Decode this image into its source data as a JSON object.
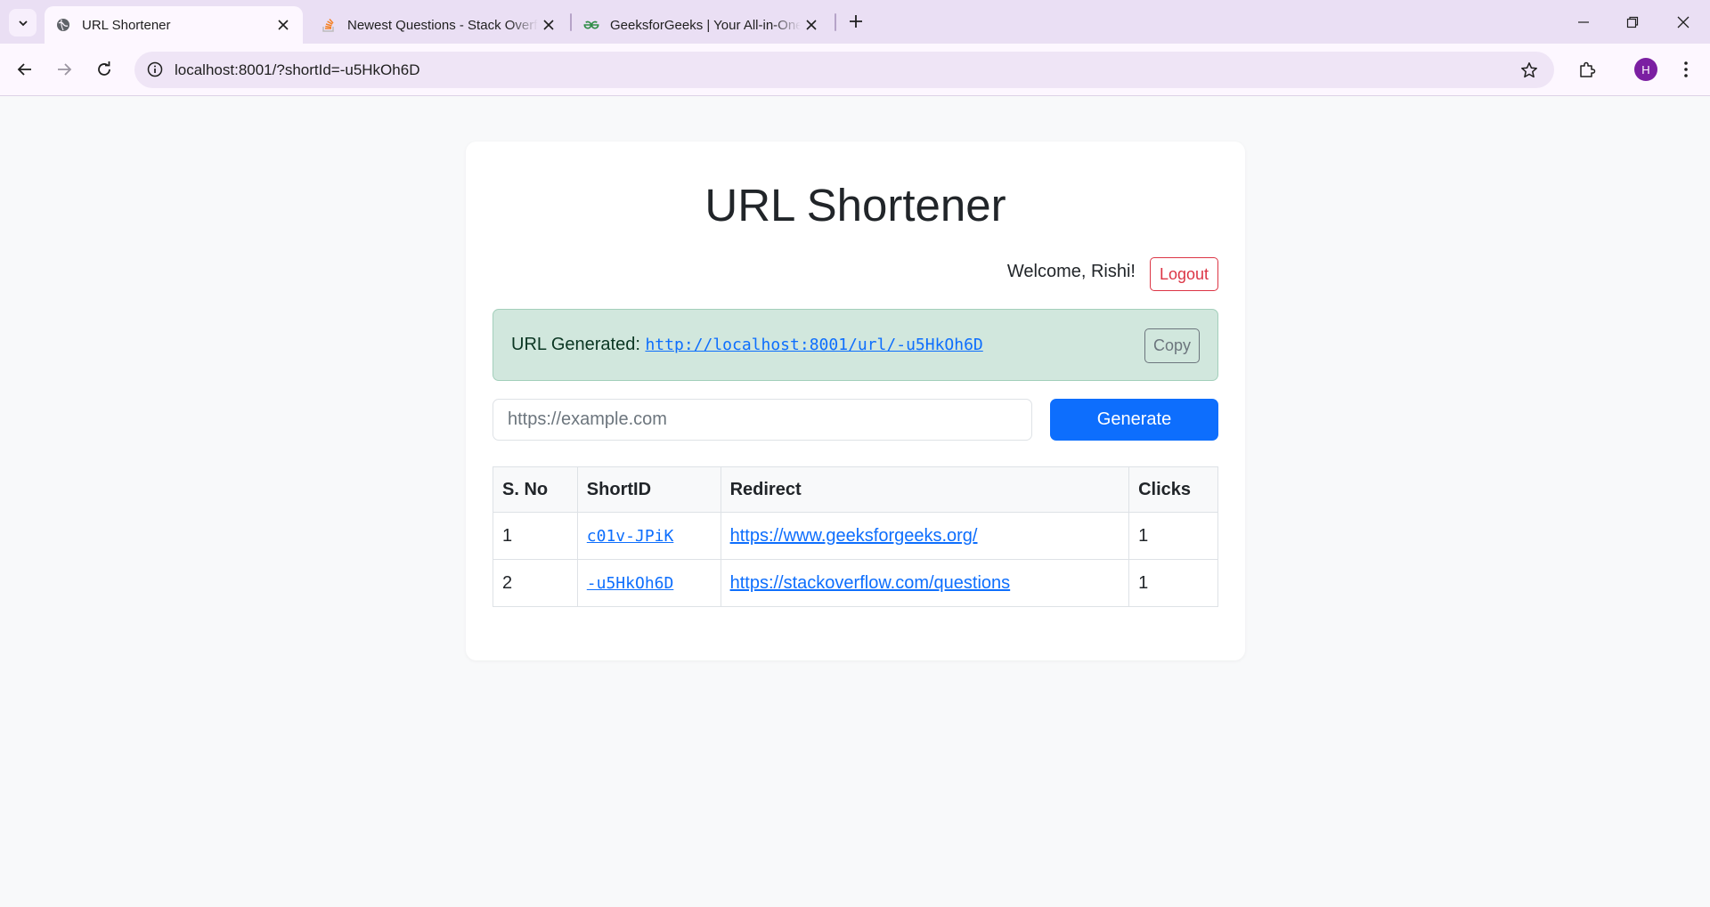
{
  "browser": {
    "tabs": [
      {
        "title": "URL Shortener",
        "favicon": "globe-icon",
        "active": true
      },
      {
        "title": "Newest Questions - Stack Overflow",
        "favicon": "stackoverflow-icon",
        "active": false
      },
      {
        "title": "GeeksforGeeks | Your All-in-One",
        "favicon": "geeksforgeeks-icon",
        "active": false
      }
    ],
    "address": "localhost:8001/?shortId=-u5HkOh6D",
    "profile_initial": "H",
    "accent": "#eadff4"
  },
  "page": {
    "title": "URL Shortener",
    "welcome": "Welcome, Rishi!",
    "logout_label": "Logout",
    "alert": {
      "label": "URL Generated:",
      "url": "http://localhost:8001/url/-u5HkOh6D",
      "copy_label": "Copy"
    },
    "input": {
      "placeholder": "https://example.com",
      "value": ""
    },
    "generate_label": "Generate",
    "table": {
      "headers": [
        "S. No",
        "ShortID",
        "Redirect",
        "Clicks"
      ],
      "rows": [
        {
          "sno": "1",
          "short_id": "c01v-JPiK",
          "redirect": "https://www.geeksforgeeks.org/",
          "clicks": "1"
        },
        {
          "sno": "2",
          "short_id": "-u5HkOh6D",
          "redirect": "https://stackoverflow.com/questions",
          "clicks": "1"
        }
      ]
    },
    "colors": {
      "primary": "#0d6efd",
      "danger": "#dc3545",
      "success_bg": "#d1e7dd",
      "secondary": "#6c757d"
    }
  }
}
